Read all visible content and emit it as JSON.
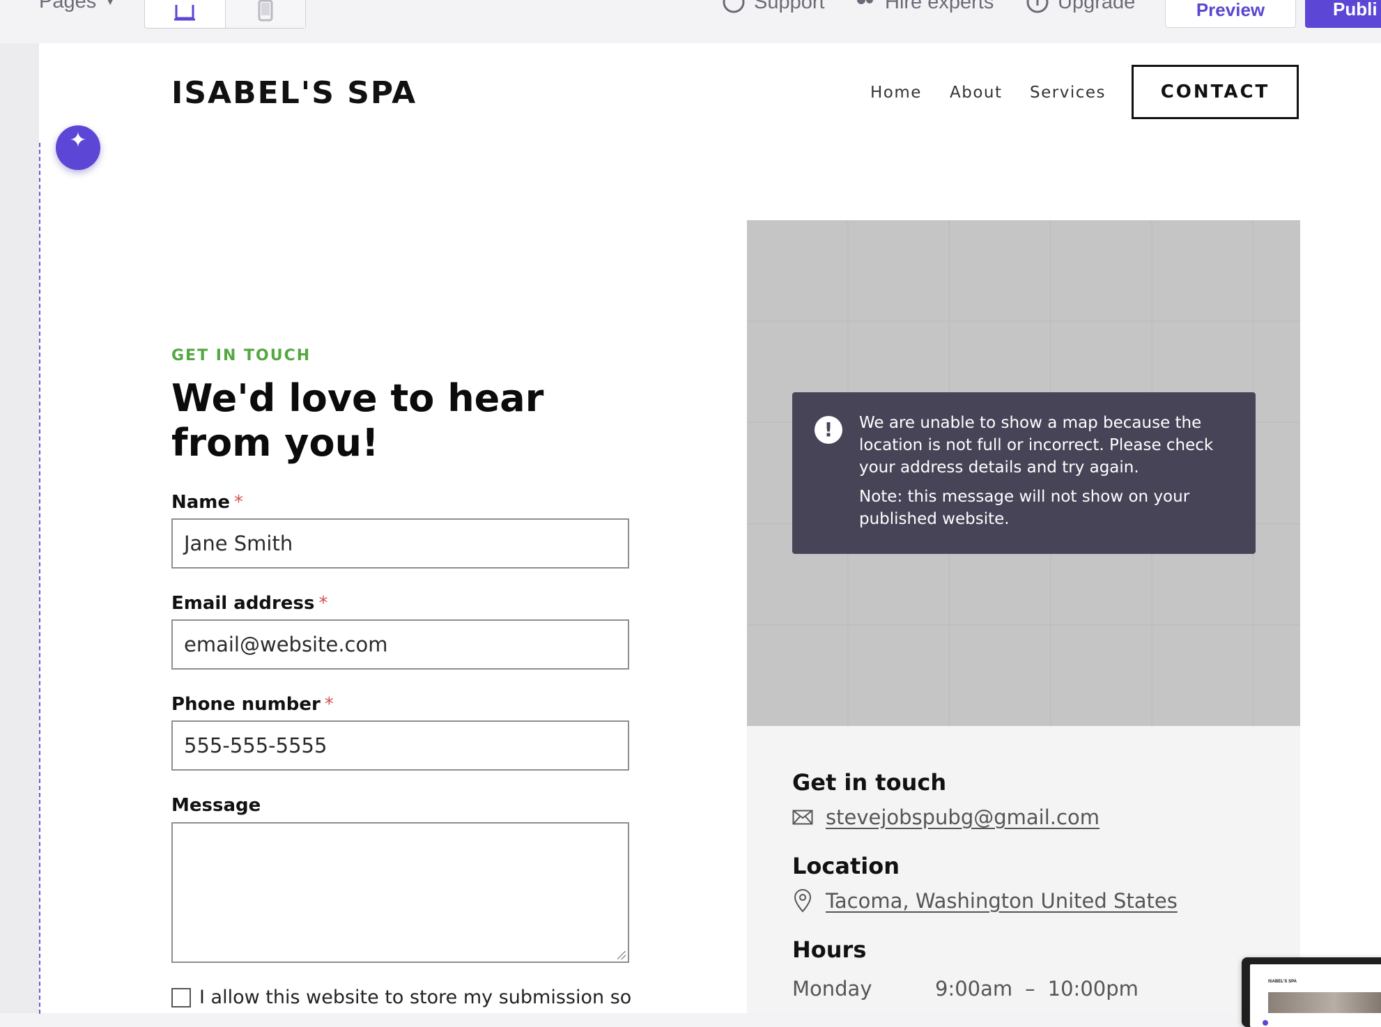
{
  "editor": {
    "pages_label": "Pages",
    "support": "Support",
    "hire_experts": "Hire experts",
    "upgrade": "Upgrade",
    "preview": "Preview",
    "publish": "Publi",
    "accent": "#5b46d6"
  },
  "site": {
    "brand": "ISABEL'S SPA",
    "nav": [
      "Home",
      "About",
      "Services"
    ],
    "contact_button": "CONTACT"
  },
  "form": {
    "eyebrow": "GET IN TOUCH",
    "heading": "We'd love to hear from you!",
    "name_label": "Name",
    "name_placeholder": "Jane Smith",
    "email_label": "Email address",
    "email_placeholder": "email@website.com",
    "phone_label": "Phone number",
    "phone_placeholder": "555-555-5555",
    "message_label": "Message",
    "required_mark": "*",
    "consent_text": "I allow this website to store my submission so",
    "eyebrow_color": "#53a841"
  },
  "map": {
    "error_message": "We are unable to show a map because the location is not full or incorrect. Please check your address details and try again.",
    "note": "Note: this message will not show on your published website.",
    "alert_symbol": "!"
  },
  "info": {
    "get_in_touch_title": "Get in touch",
    "email": "stevejobspubg@gmail.com",
    "location_title": "Location",
    "location": "Tacoma, Washington United States",
    "hours_title": "Hours",
    "hours": [
      {
        "day": "Monday",
        "open": "9:00am",
        "sep": "–",
        "close": "10:00pm"
      }
    ]
  },
  "thumbnail": {
    "brand": "ISABEL'S SPA"
  }
}
